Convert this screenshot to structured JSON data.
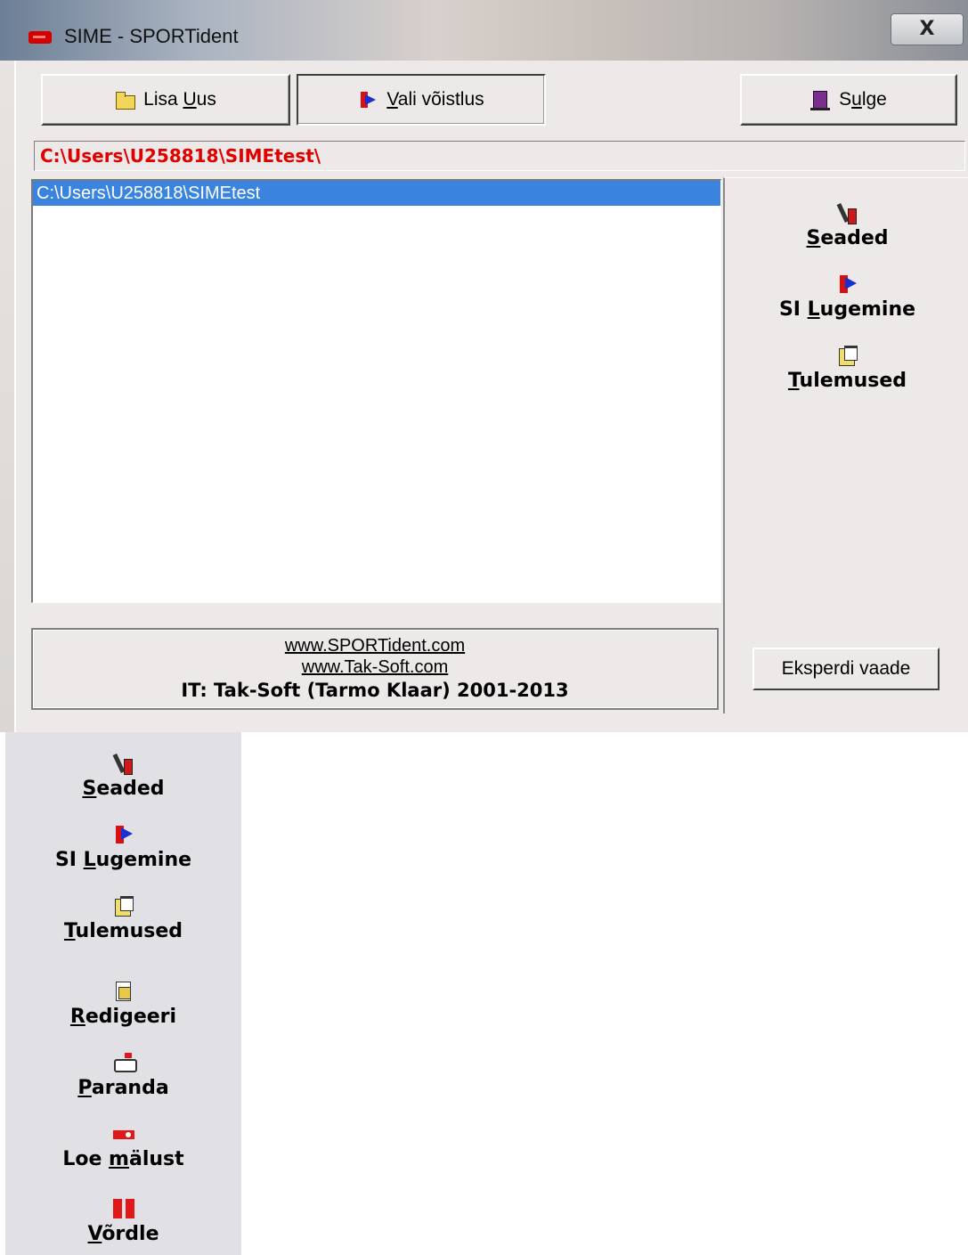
{
  "window": {
    "title": "SIME - SPORTident",
    "close_label": "X"
  },
  "toolbar": {
    "add_new": {
      "pre": "Lisa ",
      "mnemonic": "U",
      "post": "us",
      "icon": "open-folder-icon"
    },
    "select_competition": {
      "pre": "",
      "mnemonic": "V",
      "post": "ali võistlus",
      "icon": "door-arrow-icon"
    },
    "close": {
      "pre": "S",
      "mnemonic": "u",
      "post": "lge",
      "icon": "exit-door-icon"
    }
  },
  "path_bar": {
    "value": "C:\\Users\\U258818\\SIMEtest\\",
    "color": "#e00000"
  },
  "competition_list": {
    "items": [
      "C:\\Users\\U258818\\SIMEtest"
    ],
    "selected_index": 0,
    "selection_color": "#3a84e0"
  },
  "footer": {
    "link1": "www.SPORTident.com",
    "link2": "www.Tak-Soft.com",
    "credit": "IT: Tak-Soft (Tarmo Klaar) 2001-2013"
  },
  "side_menu": {
    "items": [
      {
        "mnemonic": "S",
        "rest": "eaded",
        "icon": "tools-icon"
      },
      {
        "pre": "SI ",
        "mnemonic": "L",
        "rest": "ugemine",
        "icon": "door-arrow-icon"
      },
      {
        "mnemonic": "T",
        "rest": "ulemused",
        "icon": "results-icon"
      }
    ],
    "expert_view_label": "Eksperdi vaade"
  },
  "expert_menu": {
    "items": [
      {
        "mnemonic": "S",
        "rest": "eaded",
        "icon": "tools-icon"
      },
      {
        "pre": "SI ",
        "mnemonic": "L",
        "rest": "ugemine",
        "icon": "door-arrow-icon"
      },
      {
        "mnemonic": "T",
        "rest": "ulemused",
        "icon": "results-icon"
      },
      {
        "mnemonic": "R",
        "rest": "edigeeri",
        "icon": "edit-document-icon"
      },
      {
        "mnemonic": "P",
        "rest": "aranda",
        "icon": "repair-icon"
      },
      {
        "pre": "Loe ",
        "mnemonic": "m",
        "rest": "älust",
        "icon": "memory-card-icon"
      },
      {
        "mnemonic": "V",
        "rest": "õrdle",
        "icon": "compare-icon"
      }
    ]
  }
}
